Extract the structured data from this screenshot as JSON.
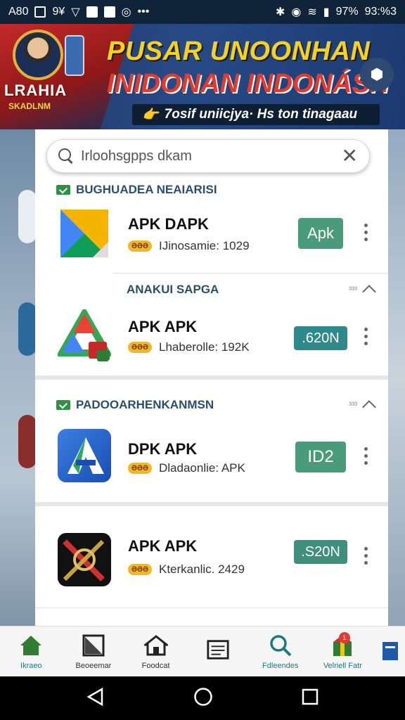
{
  "status_bar": {
    "left_text": "A80",
    "carrier_glyphs": "9¥",
    "battery": "97%",
    "time": "93:%3"
  },
  "banner": {
    "brand_name": "LRAHIA",
    "brand_sub": "SKADLNM",
    "title": "PUSAR UNOONHAN",
    "subtitle": "INIDONAN INDONÁSH",
    "tagline": "7osif uniicjya· Hs ton tinagaau",
    "tagline_icon": "👉"
  },
  "search": {
    "placeholder": "Irloohsgpps dkam"
  },
  "sections": [
    {
      "title": "BUGHUADEA NEAIARISI"
    },
    {
      "title": "ANAKUI SAPGA",
      "count": "³³³"
    },
    {
      "title": "PADOOARHENKANMSN",
      "count": "³³³"
    }
  ],
  "apps": [
    {
      "name": "APK DAPK",
      "rating": "ƏƏƏ",
      "meta": "IJinosamie: 1029",
      "action": "Apk",
      "action_color": "#4a9a7c"
    },
    {
      "name": "APK APK",
      "rating": "ƏƏƏ",
      "meta": "Lhaberolle: 192K",
      "action": ".620N",
      "action_color": "#2e8a8a"
    },
    {
      "name": "DPK APK",
      "rating": "ƏƏƏ",
      "meta": "Dladaonlie: APK",
      "action": "ID2",
      "action_color": "#4a9a7c"
    },
    {
      "name": "APK APK",
      "rating": "ƏƏƏ",
      "meta": "Kterkanlic. 2429",
      "action": ".S20N",
      "action_color": "#3f8f7a"
    }
  ],
  "bottom_nav": [
    {
      "label": "Ikraeo",
      "icon": "home-icon",
      "active": true
    },
    {
      "label": "Beoeemar",
      "icon": "bookmark-icon"
    },
    {
      "label": "Foodcat",
      "icon": "store-icon"
    },
    {
      "label": "",
      "icon": "document-icon"
    },
    {
      "label": "Fdleendes",
      "icon": "search-icon"
    },
    {
      "label": "Velriell Fatr",
      "icon": "gift-icon",
      "badge": "1"
    },
    {
      "label": "",
      "icon": "grid-icon"
    }
  ],
  "colors": {
    "accent_green": "#2f8f45",
    "nav_label_teal": "#1a7a80"
  }
}
